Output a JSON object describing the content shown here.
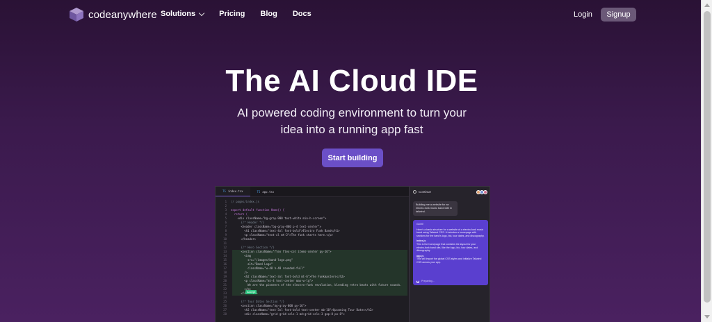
{
  "brand": {
    "name": "codeanywhere"
  },
  "nav": {
    "links": [
      {
        "label": "Solutions",
        "has_dropdown": true
      },
      {
        "label": "Pricing"
      },
      {
        "label": "Blog"
      },
      {
        "label": "Docs"
      }
    ],
    "login_label": "Login",
    "signup_label": "Signup"
  },
  "hero": {
    "title": "The AI Cloud IDE",
    "subtitle_line1": "AI powered coding environment to turn your",
    "subtitle_line2": "idea into a running app fast",
    "cta_label": "Start building"
  },
  "editor": {
    "tabs": [
      {
        "icon": "TS",
        "label": "index.tsx",
        "active": true
      },
      {
        "icon": "TS",
        "label": "app.tsx",
        "active": false
      }
    ],
    "ghost_hint": "Accept",
    "code_lines": [
      "// pages/index.js",
      "",
      "export default function Home() {",
      "  return (",
      "    <div className=\"bg-gray-900 text-white min-h-screen\">",
      "      {/* Header */}",
      "      <header className=\"bg-gray-800 p-4 text-center\">",
      "        <h1 className=\"text-4xl font-bold\">Electro Funk Band</h1>",
      "        <p className=\"text-xl mt-2\">The funk starts here.</p>",
      "      </header>",
      "",
      "      {/* Hero Section */}",
      "      <section className=\"flex flex-col items-center py-16\">",
      "        <img",
      "          src=\"/images/band-logo.png\"",
      "          alt=\"Band Logo\"",
      "          className=\"w-48 h-48 rounded-full\"",
      "        />",
      "        <h2 className=\"text-3xl font-bold mt-6\">The Funkmasters</h2>",
      "        <p className=\"mt-4 text-center max-w-lg\">",
      "          We are the pioneers of the electro-funk revolution, blending retro beats with future sounds.",
      "        </p>",
      "      </section>",
      "",
      "      {/* Tour Dates Section */}",
      "      <section className=\"bg-gray-800 py-16\">",
      "        <h2 className=\"text-3xl font-bold text-center mb-10\">Upcoming Tour Dates</h2>",
      "        <div className=\"grid grid-cols-1 md:grid-cols-3 gap-8 px-8\">"
    ]
  },
  "chat": {
    "title": "Continue",
    "user_message": "Building me a website for an electro-funk music band with in tailwind.",
    "ai_intro": "Got it!",
    "ai_text": "Here's a basic structure for a website of a electro-funk music band using Tailwind CSS. It includes a homepage with sections for the band's logo, bio, tour dates, and discography.",
    "file1": "index.js",
    "file1_text": "This is the homepage that contains the layout for your electro-funk band site, like the logo, bio, tour dates, and discography.",
    "file2": "app.js",
    "file2_text": "This will import the global CSS styles and initialize Tailwind CSS across your app.",
    "status": "Preparing..."
  },
  "colors": {
    "accent": "#6b4fc7",
    "signup_bg": "#6b5978",
    "ai_bubble": "#5a3fcf",
    "ghost": "#2ec27e"
  }
}
